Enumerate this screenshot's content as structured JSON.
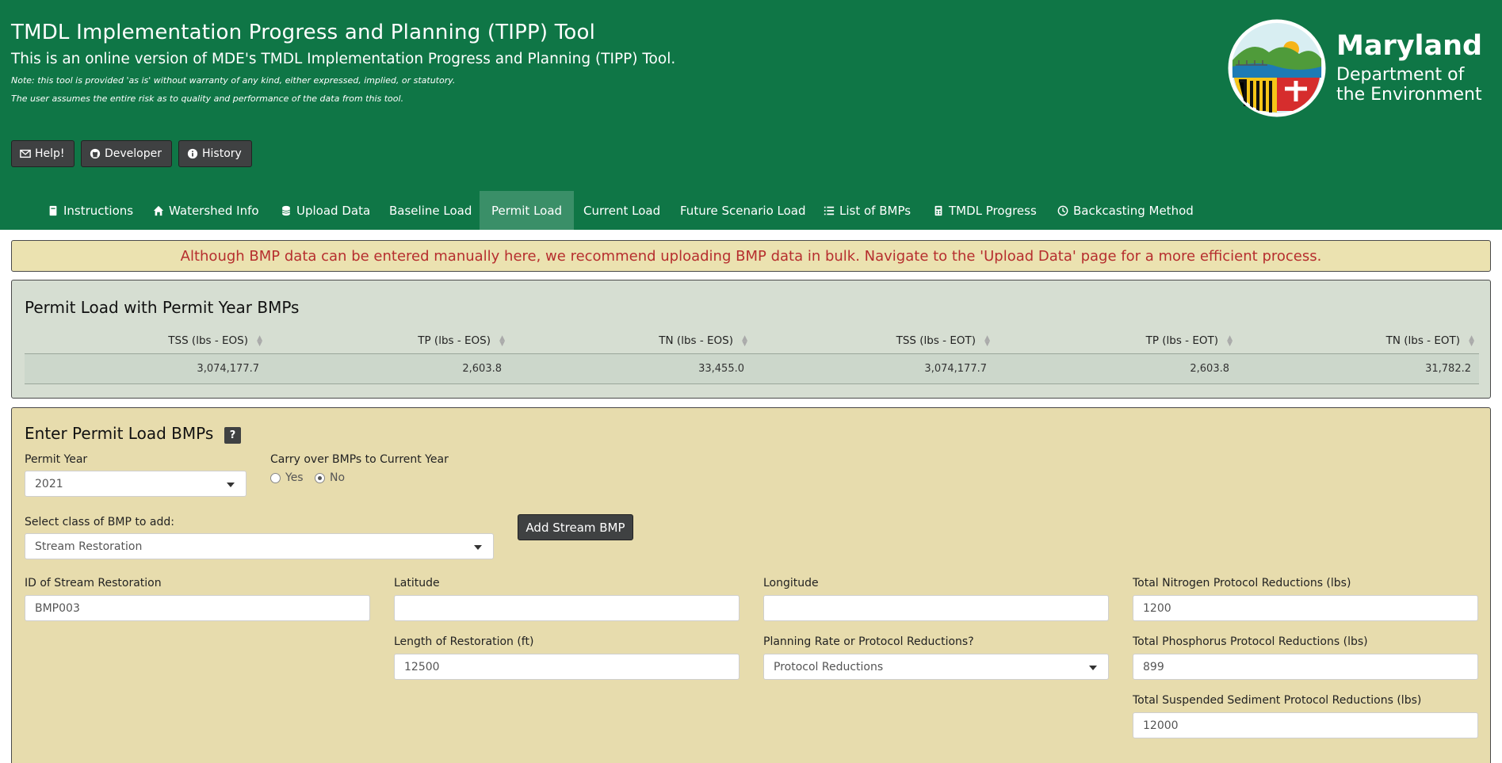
{
  "header": {
    "title": "TMDL Implementation Progress and Planning (TIPP) Tool",
    "subtitle": "This is an online version of MDE's TMDL Implementation Progress and Planning (TIPP) Tool.",
    "note1": "Note: this tool is provided 'as is' without warranty of any kind, either expressed, implied, or statutory.",
    "note2": "The user assumes the entire risk as to quality and performance of the data from this tool.",
    "buttons": [
      {
        "label": "Help!",
        "icon": "envelope-icon"
      },
      {
        "label": "Developer",
        "icon": "github-icon"
      },
      {
        "label": "History",
        "icon": "info-circle-icon"
      }
    ],
    "logo": {
      "name": "Maryland",
      "line1": "Department of",
      "line2": "the Environment"
    },
    "colors": {
      "header_bg": "#0f7646",
      "active_tab": "#3a8f68"
    }
  },
  "nav": {
    "tabs": [
      {
        "label": "Instructions",
        "icon": "book-icon"
      },
      {
        "label": "Watershed Info",
        "icon": "home-icon"
      },
      {
        "label": "Upload Data",
        "icon": "database-icon"
      },
      {
        "label": "Baseline Load",
        "icon": ""
      },
      {
        "label": "Permit Load",
        "icon": ""
      },
      {
        "label": "Current Load",
        "icon": ""
      },
      {
        "label": "Future Scenario Load",
        "icon": ""
      },
      {
        "label": "List of BMPs",
        "icon": "list-icon"
      },
      {
        "label": "TMDL Progress",
        "icon": "calculator-icon"
      },
      {
        "label": "Backcasting Method",
        "icon": "clock-icon"
      }
    ],
    "active": "Permit Load"
  },
  "alert": {
    "text": "Although BMP data can be entered manually here, we recommend uploading BMP data in bulk. Navigate to the 'Upload Data' page for a more efficient process."
  },
  "summary": {
    "title": "Permit Load with Permit Year BMPs",
    "columns": [
      "TSS (lbs - EOS)",
      "TP (lbs - EOS)",
      "TN (lbs - EOS)",
      "TSS (lbs - EOT)",
      "TP (lbs - EOT)",
      "TN (lbs - EOT)"
    ],
    "row": [
      "3,074,177.7",
      "2,603.8",
      "33,455.0",
      "3,074,177.7",
      "2,603.8",
      "31,782.2"
    ]
  },
  "form": {
    "title": "Enter Permit Load BMPs",
    "help_label": "?",
    "permit_year": {
      "label": "Permit Year",
      "value": "2021"
    },
    "carry_over": {
      "label": "Carry over BMPs to Current Year",
      "options": [
        "Yes",
        "No"
      ],
      "selected": "No"
    },
    "bmp_class": {
      "label": "Select class of BMP to add:",
      "value": "Stream Restoration"
    },
    "add_button": "Add Stream BMP",
    "id_field": {
      "label": "ID of Stream Restoration",
      "value": "BMP003"
    },
    "latitude": {
      "label": "Latitude",
      "value": ""
    },
    "longitude": {
      "label": "Longitude",
      "value": ""
    },
    "tn_reductions": {
      "label": "Total Nitrogen Protocol Reductions (lbs)",
      "value": "1200"
    },
    "length": {
      "label": "Length of Restoration (ft)",
      "value": "12500"
    },
    "rate_or_protocol": {
      "label": "Planning Rate or Protocol Reductions?",
      "value": "Protocol Reductions"
    },
    "tp_reductions": {
      "label": "Total Phosphorus Protocol Reductions (lbs)",
      "value": "899"
    },
    "tss_reductions": {
      "label": "Total Suspended Sediment Protocol Reductions (lbs)",
      "value": "12000"
    }
  }
}
